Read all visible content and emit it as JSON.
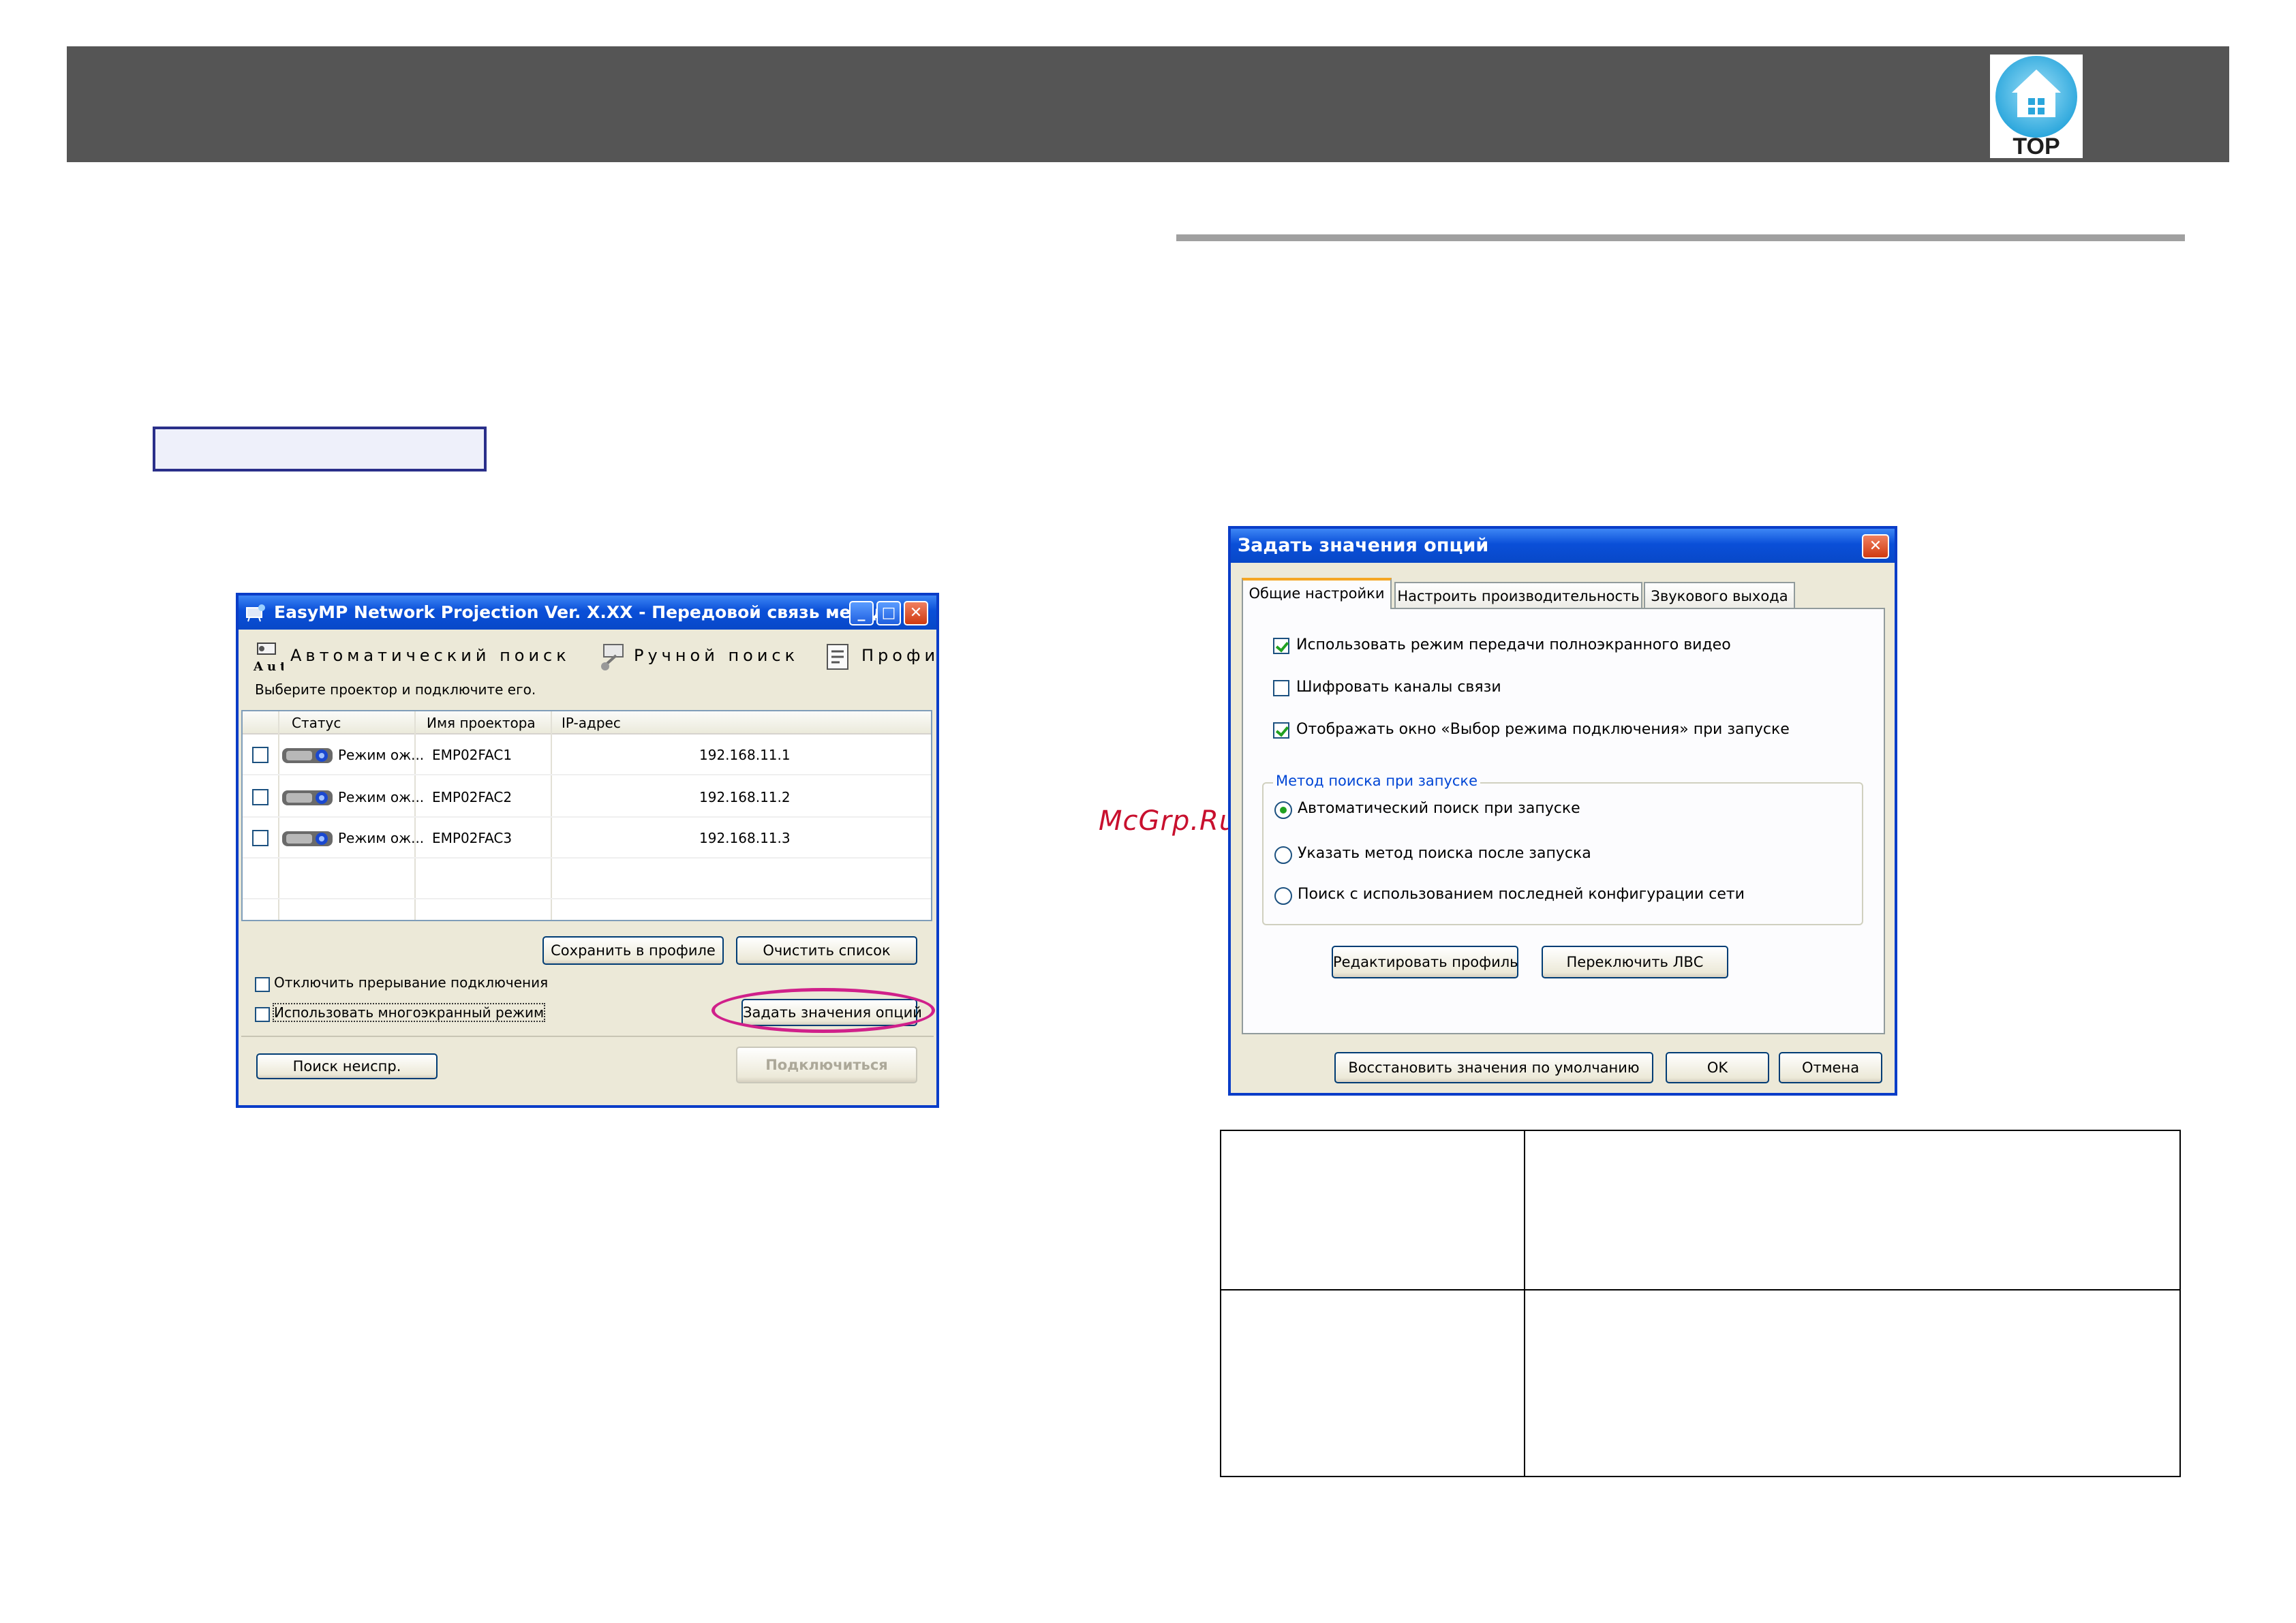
{
  "header": {
    "top_label": "TOP",
    "top_icon": "home-icon"
  },
  "watermark": "McGrp.Ru",
  "left_window": {
    "title": "EasyMP Network Projection Ver. X.XX - Передовой связь метод -",
    "toolbar": {
      "auto_search": "Автоматический поиск",
      "auto_icon_text": "Auto",
      "manual_search": "Ручной поиск",
      "profile": "Профи"
    },
    "instruction": "Выберите проектор и подключите его.",
    "columns": [
      "Статус",
      "Имя проектора",
      "IP-адрес"
    ],
    "rows": [
      {
        "status": "Режим ож...",
        "name": "EMP02FAC1",
        "ip": "192.168.11.1"
      },
      {
        "status": "Режим ож...",
        "name": "EMP02FAC2",
        "ip": "192.168.11.2"
      },
      {
        "status": "Режим ож...",
        "name": "EMP02FAC3",
        "ip": "192.168.11.3"
      }
    ],
    "buttons": {
      "save_profile": "Сохранить в профиле",
      "clear_list": "Очистить список",
      "set_options": "Задать значения опций",
      "search_fault": "Поиск неиспр.",
      "connect": "Подключиться"
    },
    "checkboxes": {
      "disable_interrupt": "Отключить прерывание подключения",
      "multi_screen": "Использовать многоэкранный режим"
    }
  },
  "options_dialog": {
    "title": "Задать значения опций",
    "tabs": [
      "Общие настройки",
      "Настроить производительность",
      "Звукового выхода"
    ],
    "checkboxes": [
      {
        "label": "Использовать режим передачи полноэкранного видео",
        "checked": true
      },
      {
        "label": "Шифровать каналы связи",
        "checked": false
      },
      {
        "label": "Отображать окно «Выбор режима подключения» при запуске",
        "checked": true
      }
    ],
    "group_label": "Метод поиска при запуске",
    "radios": [
      {
        "label": "Автоматический поиск при запуске",
        "selected": true
      },
      {
        "label": "Указать метод поиска после запуска",
        "selected": false
      },
      {
        "label": "Поиск с использованием последней конфигурации сети",
        "selected": false
      }
    ],
    "buttons": {
      "edit_profile": "Редактировать профиль",
      "switch_lan": "Переключить ЛВС",
      "restore_defaults": "Восстановить значения по умолчанию",
      "ok": "OK",
      "cancel": "Отмена"
    }
  },
  "colors": {
    "header_bar": "#555555",
    "accent_blue": "#0a3dc8",
    "highlight": "#d0208a"
  }
}
